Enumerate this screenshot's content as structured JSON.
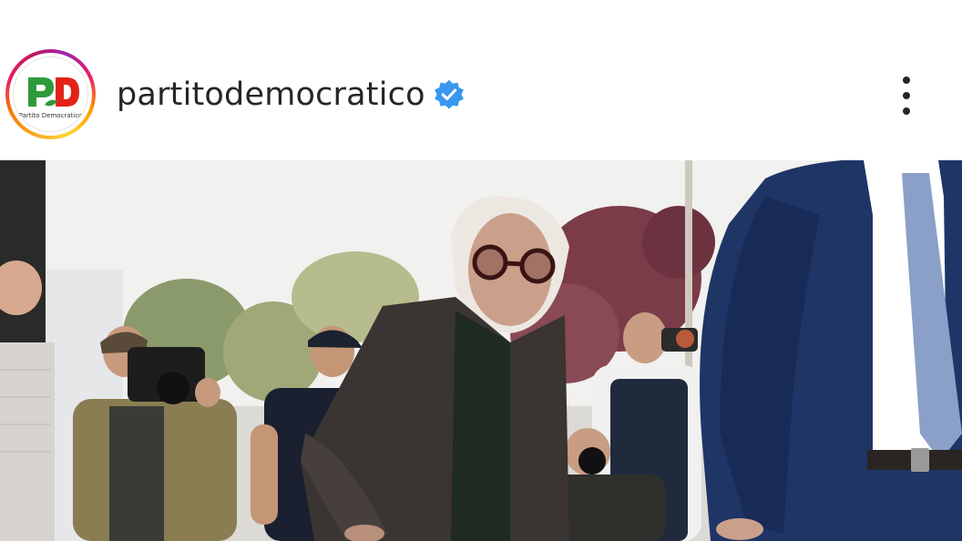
{
  "post": {
    "account": {
      "username": "partitodemocratico",
      "verified": true,
      "avatar": {
        "logo_text": "PD",
        "caption": "Partito Democratico",
        "colors": {
          "p": "#2e9b3b",
          "d": "#e2231a",
          "ring": [
            "#f9a825",
            "#e91e63",
            "#9c27b0"
          ]
        }
      }
    },
    "icons": {
      "verified": "verified-badge-icon",
      "more": "more-options-icon"
    },
    "photo": {
      "subject": "post-photo"
    }
  },
  "colors": {
    "verified_blue": "#3897f0",
    "text": "#262626"
  }
}
